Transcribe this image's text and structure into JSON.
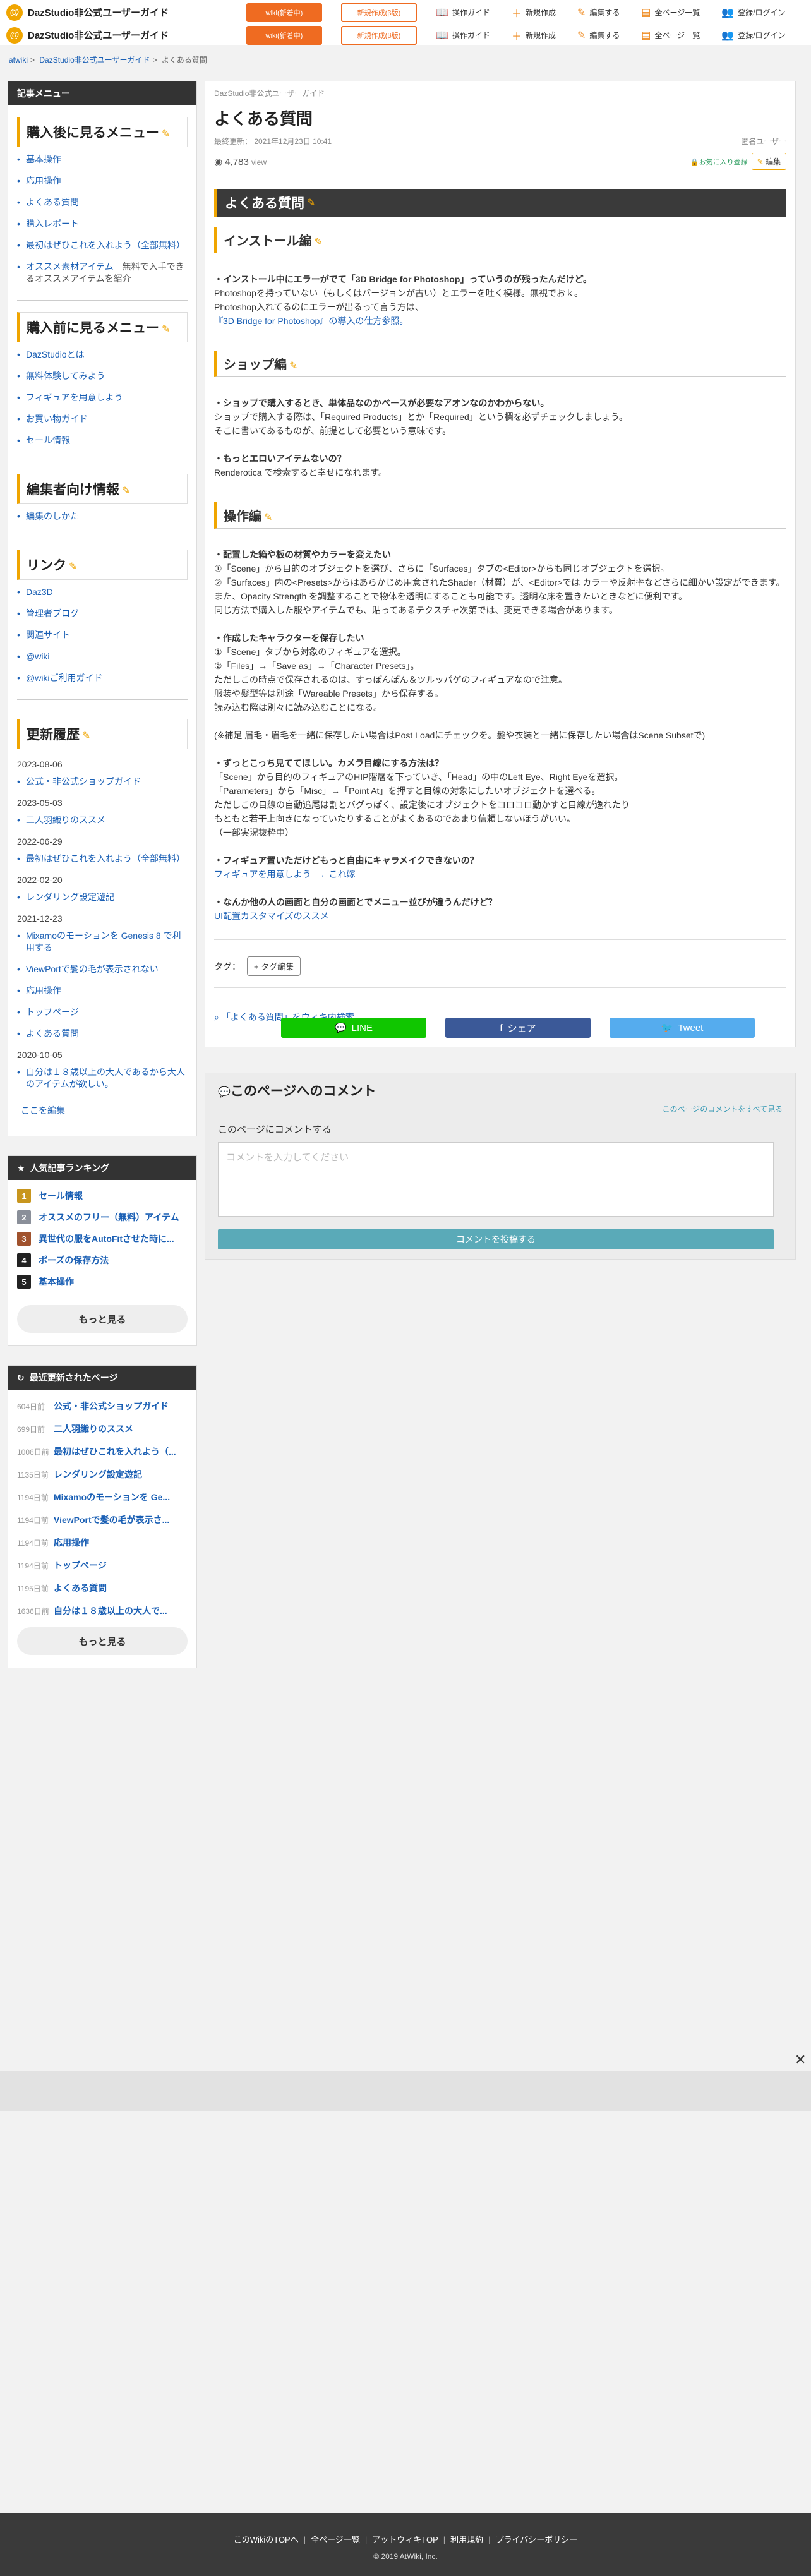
{
  "header": {
    "logo_letter": "@",
    "site_name": "DazStudio非公式ユーザーガイド",
    "wiki_btn": "wiki(新着中)",
    "mylist_btn": "新規作成(β版)",
    "links": [
      {
        "icon": "book-icon",
        "label": "操作ガイド"
      },
      {
        "icon": "plus-icon",
        "label": "新規作成"
      },
      {
        "icon": "pencil-icon",
        "label": "編集する"
      },
      {
        "icon": "doc-icon",
        "label": "全ページ一覧"
      },
      {
        "icon": "user-plus-icon",
        "label": "登録/ログイン"
      }
    ]
  },
  "breadcrumb": [
    "atwiki",
    "DazStudio非公式ユーザーガイド",
    "よくある質問"
  ],
  "sidebar": {
    "menu_head": "記事メニュー",
    "sec1_title": "購入後に見るメニュー",
    "sec1_items": [
      {
        "label": "基本操作"
      },
      {
        "label": "応用操作"
      },
      {
        "label": "よくある質問"
      },
      {
        "label": "購入レポート"
      },
      {
        "label": "最初はぜひこれを入れよう（全部無料）"
      },
      {
        "label": "オススメ素材アイテム",
        "note": "　無料で入手できるオススメアイテムを紹介"
      }
    ],
    "sec2_title": "購入前に見るメニュー",
    "sec2_items": [
      "DazStudioとは",
      "無料体験してみよう",
      "フィギュアを用意しよう",
      "お買い物ガイド",
      "セール情報"
    ],
    "sec3_title": "編集者向け情報",
    "sec3_items": [
      "編集のしかた"
    ],
    "sec4_title": "リンク",
    "sec4_items": [
      "Daz3D",
      "管理者ブログ",
      "関連サイト",
      "@wiki",
      "@wikiご利用ガイド"
    ],
    "sec5_title": "更新履歴",
    "history": [
      {
        "date": "2023-08-06",
        "items": [
          "公式・非公式ショップガイド"
        ]
      },
      {
        "date": "2023-05-03",
        "items": [
          "二人羽織りのススメ"
        ]
      },
      {
        "date": "2022-06-29",
        "items": [
          "最初はぜひこれを入れよう（全部無料）"
        ]
      },
      {
        "date": "2022-02-20",
        "items": [
          "レンダリング設定遊記"
        ]
      },
      {
        "date": "2021-12-23",
        "items": [
          "Mixamoのモーションを Genesis 8 で利用する",
          "ViewPortで髪の毛が表示されない",
          "応用操作",
          "トップページ",
          "よくある質問"
        ]
      },
      {
        "date": "2020-10-05",
        "items": [
          "自分は１８歳以上の大人であるから大人のアイテムが欲しい。"
        ]
      }
    ],
    "edit_here": "ここを編集",
    "ranking_head": "人気記事ランキング",
    "ranking": [
      {
        "num": "1",
        "color": "#c8961e",
        "title": "セール情報"
      },
      {
        "num": "2",
        "color": "#8a8f99",
        "title": "オススメのフリー（無料）アイテム"
      },
      {
        "num": "3",
        "color": "#a0522d",
        "title": "異世代の服をAutoFitさせた時に..."
      },
      {
        "num": "4",
        "color": "#222222",
        "title": "ポーズの保存方法"
      },
      {
        "num": "5",
        "color": "#222222",
        "title": "基本操作"
      }
    ],
    "more1": "もっと見る",
    "recent_head": "最近更新されたページ",
    "recent": [
      {
        "ago": "604日前",
        "title": "公式・非公式ショップガイド"
      },
      {
        "ago": "699日前",
        "title": "二人羽織りのススメ"
      },
      {
        "ago": "1006日前",
        "title": "最初はぜひこれを入れよう（..."
      },
      {
        "ago": "1135日前",
        "title": "レンダリング設定遊記"
      },
      {
        "ago": "1194日前",
        "title": "Mixamoのモーションを Ge..."
      },
      {
        "ago": "1194日前",
        "title": "ViewPortで髪の毛が表示さ..."
      },
      {
        "ago": "1194日前",
        "title": "応用操作"
      },
      {
        "ago": "1194日前",
        "title": "トップページ"
      },
      {
        "ago": "1195日前",
        "title": "よくある質問"
      },
      {
        "ago": "1636日前",
        "title": "自分は１８歳以上の大人で..."
      }
    ],
    "more2": "もっと見る"
  },
  "main": {
    "site_sub": "DazStudio非公式ユーザーガイド",
    "title": "よくある質問",
    "updated": "最終更新： 2021年12月23日 10:41",
    "author": "匿名ユーザー",
    "views": "4,783",
    "views_unit": "view",
    "fav": "お気に入り登録",
    "edit": "編集",
    "h2": "よくある質問",
    "sections": [
      {
        "h3": "インストール編",
        "lines": [
          {
            "t": "・インストール中にエラーがでて「3D Bridge for Photoshop」っていうのが残ったんだけど。",
            "q": true
          },
          {
            "t": "Photoshopを持っていない（もしくはバージョンが古い）とエラーを吐く模様。無視でおｋ。"
          },
          {
            "t": "Photoshop入れてるのにエラーが出るって言う方は、"
          },
          {
            "t": "『3D Bridge for Photoshop』の導入の仕方参照。",
            "link": true
          }
        ]
      },
      {
        "h3": "ショップ編",
        "lines": [
          {
            "t": "・ショップで購入するとき、単体品なのかベースが必要なアオンなのかわからない。",
            "q": true
          },
          {
            "t": "ショップで購入する際は、「Required Products」とか「Required」という欄を必ずチェックしましょう。"
          },
          {
            "t": "そこに書いてあるものが、前提として必要という意味です。"
          },
          {
            "gap": true
          },
          {
            "t": "・もっとエロいアイテムないの？",
            "q": true
          },
          {
            "t": "Renderotica で検索すると幸せになれます。"
          }
        ]
      },
      {
        "h3": "操作編",
        "lines": [
          {
            "t": "・配置した箱や板の材質やカラーを変えたい",
            "q": true
          },
          {
            "t": "①「Scene」から目的のオブジェクトを選び、さらに「Surfaces」タブの<Editor>からも同じオブジェクトを選択。"
          },
          {
            "t": "②「Surfaces」内の<Presets>からはあらかじめ用意されたShader（材質）が、<Editor>では カラーや反射率などさらに細かい設定ができます。"
          },
          {
            "t": "また、Opacity Strength を調整することで物体を透明にすることも可能です。透明な床を置きたいときなどに便利です。"
          },
          {
            "t": "同じ方法で購入した服やアイテムでも、貼ってあるテクスチャ次第では、変更できる場合があります。"
          },
          {
            "gap": true
          },
          {
            "t": "・作成したキャラクターを保存したい",
            "q": true
          },
          {
            "t": "①「Scene」タブから対象のフィギュアを選択。"
          },
          {
            "t": "②「Files」→「Save as」→「Character Presets」。"
          },
          {
            "t": "ただしこの時点で保存されるのは、すっぽんぽん＆ツルッパゲのフィギュアなので注意。"
          },
          {
            "t": "服装や髪型等は別途「Wareable Presets」から保存する。"
          },
          {
            "t": "読み込む際は別々に読み込むことになる。"
          },
          {
            "gap": true
          },
          {
            "t": "(※補足 眉毛・眉毛を一緒に保存したい場合はPost Loadにチェックを。髪や衣装と一緒に保存したい場合はScene Subsetで)"
          },
          {
            "gap": true
          },
          {
            "t": "・ずっとこっち見ててほしい。カメラ目線にする方法は？",
            "q": true
          },
          {
            "t": "「Scene」から目的のフィギュアのHIP階層を下っていき、「Head」の中のLeft Eye、Right Eyeを選択。"
          },
          {
            "t": "「Parameters」から「Misc」→「Point At」を押すと目線の対象にしたいオブジェクトを選べる。"
          },
          {
            "t": "ただしこの目線の自動追尾は割とバグっぽく、設定後にオブジェクトをコロコロ動かすと目線が逸れたり"
          },
          {
            "t": "もともと若干上向きになっていたりすることがよくあるのであまり信頼しないほうがいい。"
          },
          {
            "t": "（一部実況抜粋中）"
          },
          {
            "gap": true
          },
          {
            "t": "・フィギュア置いただけどもっと自由にキャラメイクできないの？",
            "q": true
          },
          {
            "t": "フィギュアを用意しよう　←これ嫁",
            "link": true
          },
          {
            "gap": true
          },
          {
            "t": "・なんか他の人の画面と自分の画面とでメニュー並びが違うんだけど？",
            "q": true
          },
          {
            "t": "UI配置カスタマイズのススメ",
            "link": true
          }
        ]
      }
    ],
    "tag_label": "タグ：",
    "tag_btn": "+ タグ編集",
    "search_link": "「よくある質問」をウィキ内検索",
    "share": [
      {
        "label": "LINE",
        "color": "#10c600",
        "icon": "line-icon"
      },
      {
        "label": "シェア",
        "color": "#3b5998",
        "icon": "facebook-icon"
      },
      {
        "label": "Tweet",
        "color": "#55acee",
        "icon": "twitter-icon"
      }
    ]
  },
  "comment": {
    "title": "このページへのコメント",
    "all": "このページのコメントをすべて見る",
    "label": "このページにコメントする",
    "placeholder": "コメントを入力してください",
    "submit": "コメントを投稿する"
  },
  "footer": {
    "links": [
      "このWikiのTOPへ",
      "全ページ一覧",
      "アットウィキTOP",
      "利用規約",
      "プライバシーポリシー"
    ],
    "copy": "2019 AtWiki, Inc."
  }
}
